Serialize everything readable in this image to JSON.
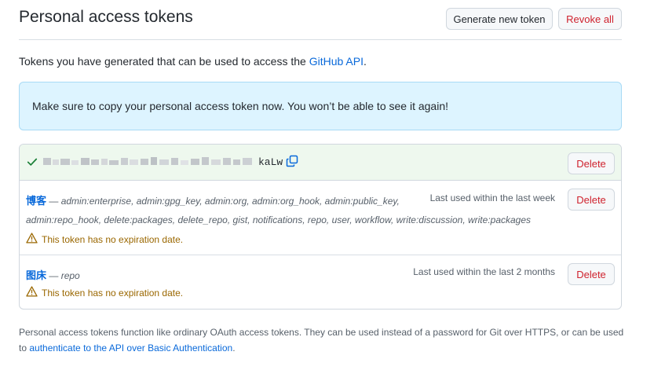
{
  "header": {
    "title": "Personal access tokens",
    "generate_label": "Generate new token",
    "revoke_label": "Revoke all"
  },
  "intro": {
    "text": "Tokens you have generated that can be used to access the ",
    "link": "GitHub API",
    "end": "."
  },
  "flash": {
    "message": "Make sure to copy your personal access token now. You won’t be able to see it again!"
  },
  "tokens": [
    {
      "token_suffix": "kaLw",
      "delete_label": "Delete"
    },
    {
      "name": "博客",
      "separator": "—",
      "scopes_line1": "admin:enterprise, admin:gpg_key, admin:org, admin:org_hook, admin:public_key,",
      "scopes_line2": "admin:repo_hook, delete:packages, delete_repo, gist, notifications, repo, user, workflow, write:discussion, write:packages",
      "last_used": "Last used within the last week",
      "warning": "This token has no expiration date.",
      "delete_label": "Delete"
    },
    {
      "name": "图床",
      "separator": "—",
      "scopes_line1": "repo",
      "last_used": "Last used within the last 2 months",
      "warning": "This token has no expiration date.",
      "delete_label": "Delete"
    }
  ],
  "footer": {
    "text": "Personal access tokens function like ordinary OAuth access tokens. They can be used instead of a password for Git over HTTPS, or can be used to ",
    "link": "authenticate to the API over Basic Authentication",
    "end": "."
  },
  "colors": {
    "accent_link": "#0969da",
    "danger": "#cf222e",
    "success": "#1a7f37",
    "attention": "#9a6700",
    "flash_bg": "#ddf4ff",
    "new_token_bg": "#eef8ee"
  },
  "icons": {
    "check": "check-icon",
    "copy": "copy-icon",
    "warning": "alert-triangle-icon"
  }
}
